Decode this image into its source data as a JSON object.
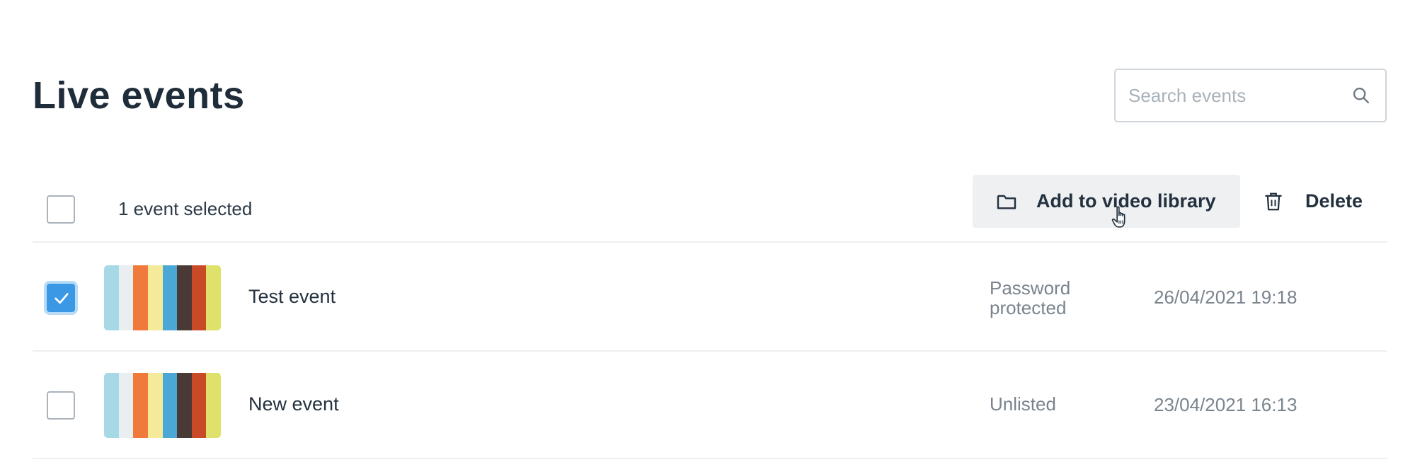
{
  "page": {
    "title": "Live events"
  },
  "search": {
    "placeholder": "Search events",
    "value": ""
  },
  "toolbar": {
    "selected_count_label": "1 event selected",
    "add_library_label": "Add to video library",
    "delete_label": "Delete"
  },
  "thumbnail_colors": [
    "#a6d8e6",
    "#e9eef0",
    "#f07a3c",
    "#f4ea9a",
    "#4aa7d6",
    "#4a3a36",
    "#c94a26",
    "#dfe26a"
  ],
  "events": [
    {
      "name": "Test event",
      "privacy": "Password protected",
      "date": "26/04/2021 19:18",
      "selected": true
    },
    {
      "name": "New event",
      "privacy": "Unlisted",
      "date": "23/04/2021 16:13",
      "selected": false
    }
  ]
}
